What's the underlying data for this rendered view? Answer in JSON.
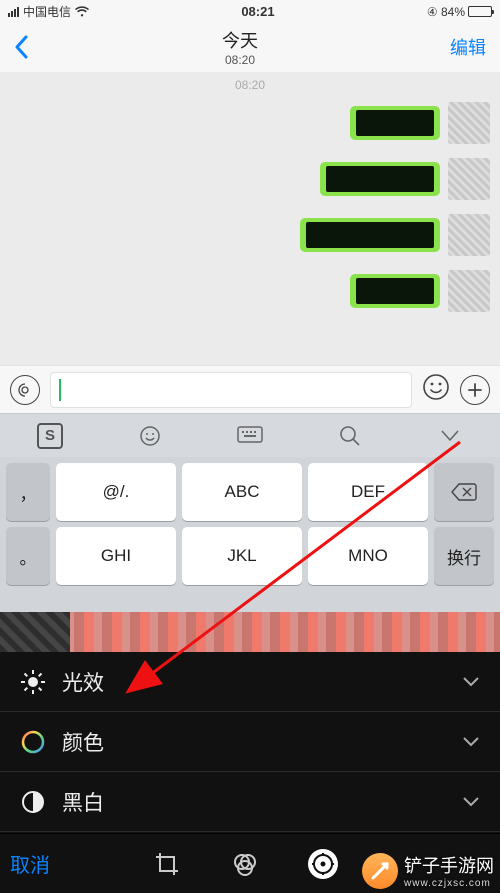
{
  "status": {
    "carrier": "中国电信",
    "time": "08:21",
    "battery_pct": "84%"
  },
  "nav": {
    "title": "今天",
    "subtitle": "08:20",
    "edit_label": "编辑"
  },
  "chat": {
    "timestamp": "08:20"
  },
  "keyboard": {
    "logo": "S",
    "rows": [
      {
        "side_left": "，",
        "keys": [
          "@/.",
          "ABC",
          "DEF"
        ],
        "side_right_icon": "backspace"
      },
      {
        "side_left": "。",
        "keys": [
          "GHI",
          "JKL",
          "MNO"
        ],
        "side_right": "换行"
      }
    ]
  },
  "adjust": {
    "items": [
      {
        "id": "light",
        "label": "光效"
      },
      {
        "id": "color",
        "label": "颜色"
      },
      {
        "id": "bw",
        "label": "黑白"
      }
    ]
  },
  "bottom": {
    "cancel": "取消"
  },
  "watermark": {
    "name": "铲子手游网",
    "url": "www.czjxsc.com"
  }
}
